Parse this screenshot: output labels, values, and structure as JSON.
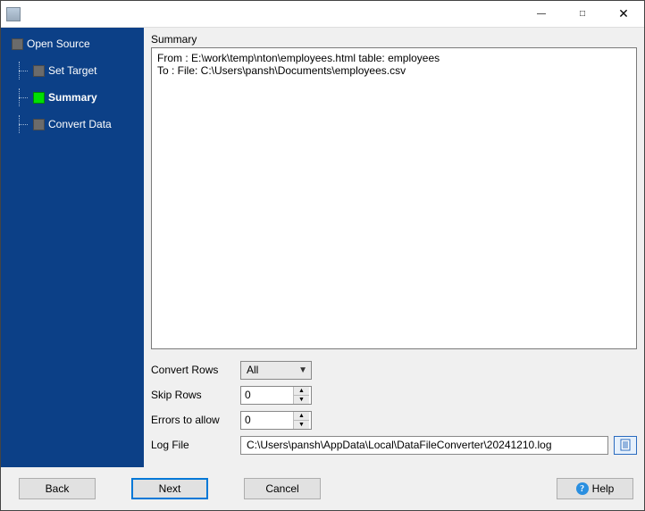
{
  "titlebar": {
    "title": ""
  },
  "sidebar": {
    "root": "Open Source",
    "steps": [
      {
        "label": "Set Target",
        "active": false
      },
      {
        "label": "Summary",
        "active": true
      },
      {
        "label": "Convert Data",
        "active": false
      }
    ]
  },
  "summary": {
    "label": "Summary",
    "text": "From : E:\\work\\temp\\nton\\employees.html table: employees\nTo : File: C:\\Users\\pansh\\Documents\\employees.csv"
  },
  "form": {
    "convert_rows": {
      "label": "Convert Rows",
      "value": "All"
    },
    "skip_rows": {
      "label": "Skip Rows",
      "value": "0"
    },
    "errors_to_allow": {
      "label": "Errors to allow",
      "value": "0"
    },
    "log_file": {
      "label": "Log File",
      "value": "C:\\Users\\pansh\\AppData\\Local\\DataFileConverter\\20241210.log"
    }
  },
  "footer": {
    "back": "Back",
    "next": "Next",
    "cancel": "Cancel",
    "help": "Help"
  }
}
